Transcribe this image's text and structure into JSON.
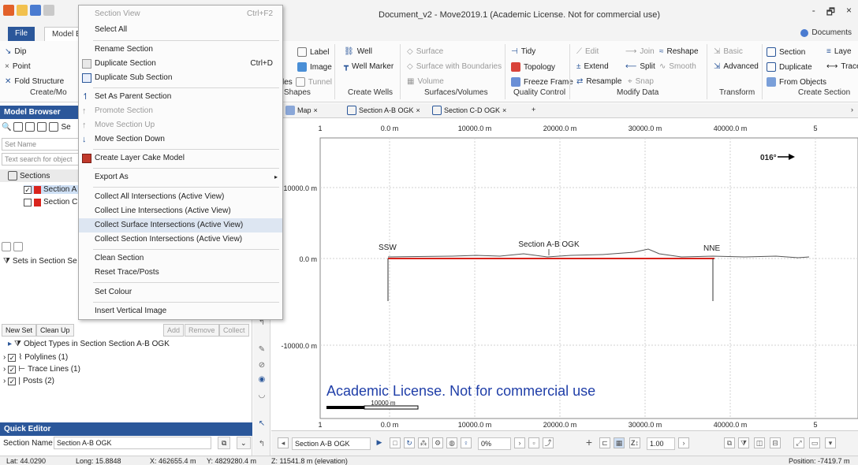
{
  "window": {
    "title": "Document_v2 - Move2019.1 (Academic License. Not for commercial use)",
    "controls": [
      "-",
      "🗗",
      "×"
    ]
  },
  "ribbon": {
    "tabs": {
      "file": "File",
      "model": "Model B"
    },
    "documents": "Documents",
    "col1": [
      "Dip",
      "Point",
      "Fold Structure"
    ],
    "col1_group": "Create/Mo",
    "col2": {
      "label": "Label",
      "image": "Image",
      "tunnel": "Tunnel",
      "les": "les"
    },
    "col2_group": "Shapes",
    "col3": [
      "Well",
      "Well Marker"
    ],
    "col3_group": "Create Wells",
    "col4": [
      "Surface",
      "Surface with Boundaries",
      "Volume"
    ],
    "col4_group": "Surfaces/Volumes",
    "col5": [
      "Tidy",
      "Topology",
      "Freeze Frame"
    ],
    "col5_group": "Quality Control",
    "col6": {
      "edit": "Edit",
      "join": "Join",
      "reshape": "Reshape",
      "extend": "Extend",
      "split": "Split",
      "smooth": "Smooth",
      "resample": "Resample",
      "snap": "Snap"
    },
    "col6_group": "Modify Data",
    "col7": [
      "Basic",
      "Advanced"
    ],
    "col7_group": "Transform",
    "col8": [
      "Section",
      "Duplicate",
      "From Objects"
    ],
    "col8_group": "Create Section",
    "col9": [
      "Laye",
      "Trace"
    ]
  },
  "left": {
    "model_browser": "Model Browser",
    "search_tail": "Se",
    "set_name_placeholder": "Set Name",
    "text_search_placeholder": "Text search for object",
    "sections_label": "Sections",
    "section_items": [
      "Section A",
      "Section C"
    ],
    "sets_label": "Sets in Section Se",
    "buttons": {
      "new_set": "New Set",
      "clean_up": "Clean Up",
      "add": "Add",
      "remove": "Remove",
      "collect": "Collect"
    },
    "object_types_title": "Object Types in Section Section A-B OGK",
    "object_types": [
      "Polylines (1)",
      "Trace Lines (1)",
      "Posts (2)"
    ],
    "quick_editor": "Quick Editor",
    "section_name_label": "Section Name",
    "section_name_value": "Section A-B OGK"
  },
  "doc_tabs": {
    "map": "Map",
    "tab_ab": "Section A-B OGK",
    "tab_cd": "Section C-D OGK",
    "plus": "+"
  },
  "view": {
    "x_ticks": [
      "0.0 m",
      "10000.0 m",
      "20000.0 m",
      "30000.0 m",
      "40000.0 m"
    ],
    "x_edge": "5",
    "x_left_edge": "1",
    "y_ticks": [
      "10000.0 m",
      "0.0 m",
      "-10000.0 m"
    ],
    "azimuth": "016°",
    "ssw": "SSW",
    "nne": "NNE",
    "section_label": "Section A-B OGK",
    "watermark": "Academic License. Not for commercial use",
    "scale_bar": "10000 m",
    "colors": {
      "section_line": "#d9241d",
      "watermark": "#1f3ea8",
      "grid": "#d0d0d0"
    }
  },
  "bottombar": {
    "section_select": "Section A-B OGK",
    "percent": "0%",
    "scale": "1.00",
    "z_label": "Z↕"
  },
  "status": {
    "lat": "Lat: 44.0290",
    "long": "Long: 15.8848",
    "x": "X: 462655.4 m",
    "y": "Y: 4829280.4 m",
    "z": "Z: 11541.8 m (elevation)",
    "position": "Position: -7419.7 m"
  },
  "menu": {
    "section_view": "Section View",
    "section_view_sc": "Ctrl+F2",
    "select_all": "Select All",
    "rename": "Rename Section",
    "duplicate": "Duplicate Section",
    "duplicate_sc": "Ctrl+D",
    "duplicate_sub": "Duplicate Sub Section",
    "set_parent": "Set As Parent Section",
    "promote": "Promote Section",
    "move_up": "Move Section Up",
    "move_down": "Move Section Down",
    "layer_cake": "Create Layer Cake Model",
    "export_as": "Export As",
    "collect_all": "Collect All Intersections (Active View)",
    "collect_line": "Collect Line Intersections (Active View)",
    "collect_surface": "Collect Surface Intersections (Active View)",
    "collect_section": "Collect Section Intersections (Active View)",
    "clean": "Clean Section",
    "reset": "Reset Trace/Posts",
    "set_colour": "Set Colour",
    "insert_image": "Insert Vertical Image"
  }
}
